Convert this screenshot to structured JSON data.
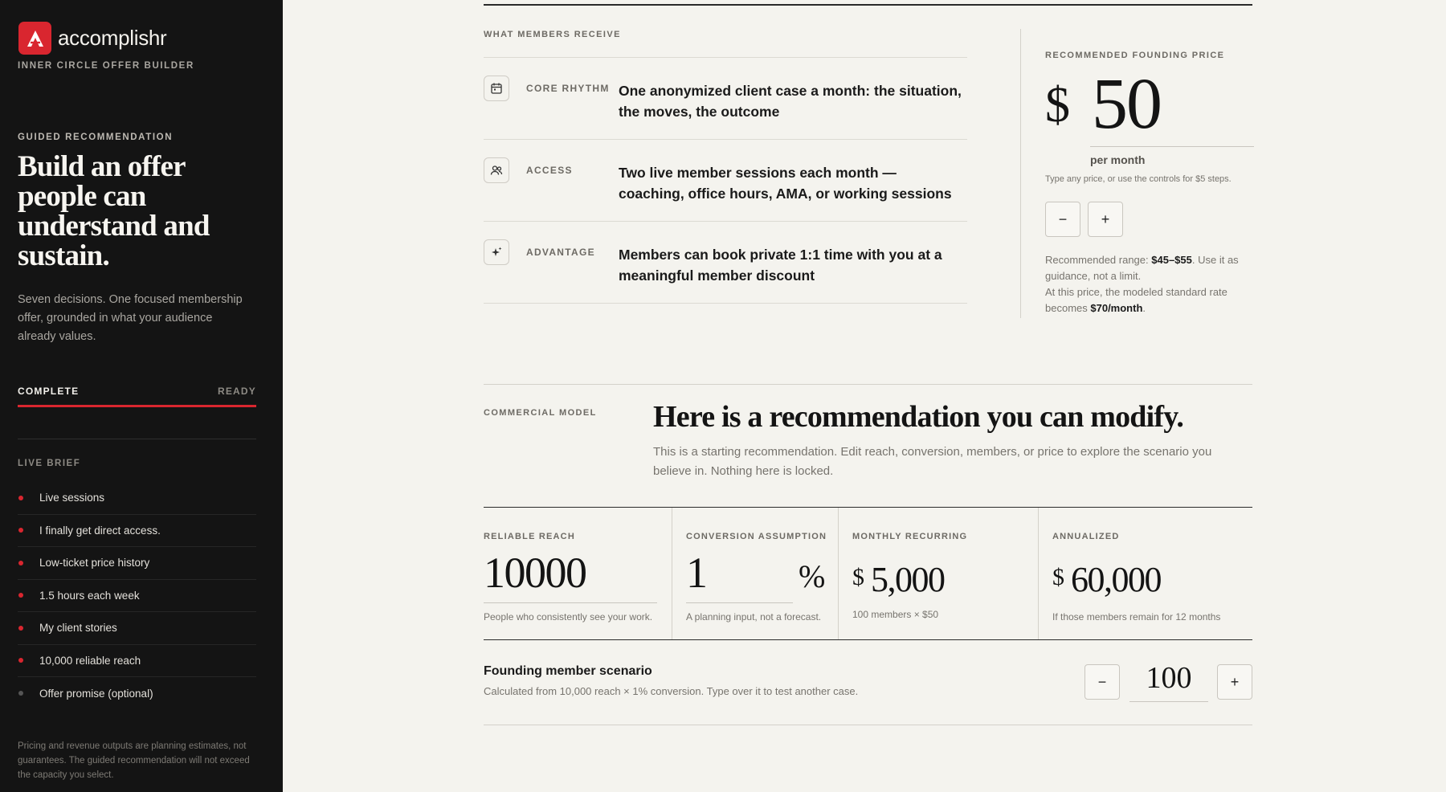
{
  "sidebar": {
    "brand": "accomplishr",
    "sub_brand": "INNER CIRCLE OFFER BUILDER",
    "guided_label": "GUIDED RECOMMENDATION",
    "hero_title": "Build an offer people can understand and sustain.",
    "hero_desc": "Seven decisions. One focused membership offer, grounded in what your audience already values.",
    "progress_left": "COMPLETE",
    "progress_right": "READY",
    "progress_fraction": 1.0,
    "live_brief_label": "LIVE BRIEF",
    "brief_items": [
      {
        "label": "Live sessions",
        "active": true
      },
      {
        "label": "I finally get direct access.",
        "active": true
      },
      {
        "label": "Low-ticket price history",
        "active": true
      },
      {
        "label": "1.5 hours each week",
        "active": true
      },
      {
        "label": "My client stories",
        "active": true
      },
      {
        "label": "10,000 reliable reach",
        "active": true
      },
      {
        "label": "Offer promise (optional)",
        "active": false
      }
    ],
    "disclaimer": "Pricing and revenue outputs are planning estimates, not guarantees. The guided recommendation will not exceed the capacity you select."
  },
  "members": {
    "label": "WHAT MEMBERS RECEIVE",
    "benefits": [
      {
        "icon": "calendar-icon",
        "label": "CORE RHYTHM",
        "text": "One anonymized client case a month: the situation, the moves, the outcome"
      },
      {
        "icon": "users-icon",
        "label": "ACCESS",
        "text": "Two live member sessions each month — coaching, office hours, AMA, or working sessions"
      },
      {
        "icon": "sparkle-icon",
        "label": "ADVANTAGE",
        "text": "Members can book private 1:1 time with you at a meaningful member discount"
      }
    ]
  },
  "price": {
    "label": "RECOMMENDED FOUNDING PRICE",
    "currency": "$",
    "value": "50",
    "per": "per month",
    "hint": "Type any price, or use the controls for $5 steps.",
    "minus": "−",
    "plus": "+",
    "range_pre": "Recommended range: ",
    "range_value": "$45–$55",
    "range_post": ". Use it as guidance, not a limit.",
    "standard_pre": "At this price, the modeled standard rate becomes ",
    "standard_value": "$70/month",
    "standard_post": "."
  },
  "commercial": {
    "label": "COMMERCIAL MODEL",
    "title": "Here is a recommendation you can modify.",
    "desc": "This is a starting recommendation. Edit reach, conversion, members, or price to explore the scenario you believe in. Nothing here is locked."
  },
  "metrics": {
    "reach": {
      "label": "RELIABLE REACH",
      "value": "10000",
      "foot": "People who consistently see your work."
    },
    "conversion": {
      "label": "CONVERSION ASSUMPTION",
      "value": "1",
      "unit": "%",
      "foot": "A planning input, not a forecast."
    },
    "monthly": {
      "label": "MONTHLY RECURRING",
      "currency": "$",
      "value": "5,000",
      "foot": "100 members × $50"
    },
    "annual": {
      "label": "ANNUALIZED",
      "currency": "$",
      "value": "60,000",
      "foot": "If those members remain for 12 months"
    }
  },
  "scenario": {
    "title": "Founding member scenario",
    "desc": "Calculated from 10,000 reach × 1% conversion. Type over it to test another case.",
    "minus": "−",
    "plus": "+",
    "value": "100"
  },
  "colors": {
    "accent": "#d9262f",
    "sidebar_bg": "#141414",
    "page_bg": "#f4f3ee"
  }
}
